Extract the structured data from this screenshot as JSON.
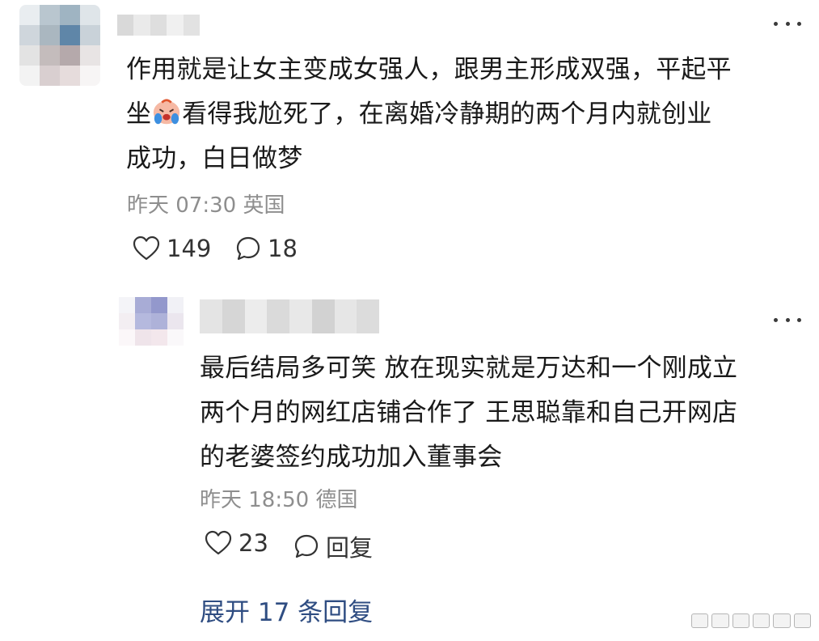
{
  "comment1": {
    "text_lines": [
      "作用就是让女主变成女强人，跟男主形成双强，平起平",
      "坐",
      "看得我尬死了，在离婚冷静期的两个月内就创业",
      "成功，白日做梦"
    ],
    "emoji": "crying-face-emoji",
    "time": "昨天 07:30",
    "location": "英国",
    "likes": "149",
    "comments": "18"
  },
  "reply1": {
    "text_lines": [
      "最后结局多可笑 放在现实就是万达和一个刚成立",
      "两个月的网红店铺合作了 王思聪靠和自己开网店",
      "的老婆签约成功加入董事会"
    ],
    "time": "昨天 18:50",
    "location": "德国",
    "likes": "23",
    "reply_label": "回复"
  },
  "expand_label": "展开 17 条回复",
  "icons": {
    "like": "heart-icon",
    "comment": "comment-bubble-icon",
    "more": "more-dots-icon"
  },
  "colors": {
    "link": "#2f4d82",
    "meta": "#8e8e8e",
    "text": "#1a1a1a"
  }
}
